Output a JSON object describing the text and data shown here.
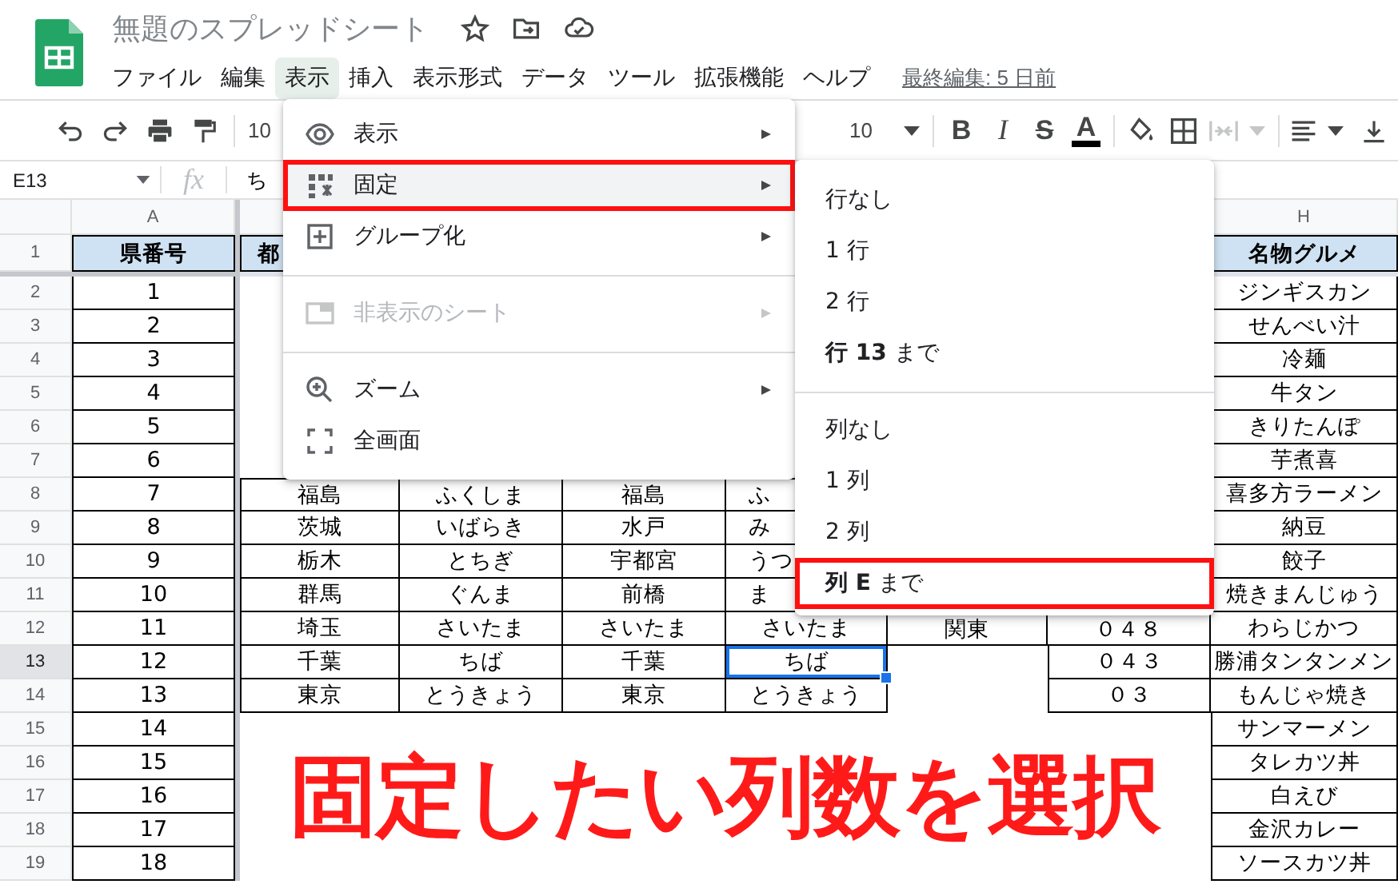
{
  "header": {
    "title": "無題のスプレッドシート",
    "menus": [
      {
        "label": "ファイル",
        "selected": false
      },
      {
        "label": "編集",
        "selected": false
      },
      {
        "label": "表示",
        "selected": true
      },
      {
        "label": "挿入",
        "selected": false
      },
      {
        "label": "表示形式",
        "selected": false
      },
      {
        "label": "データ",
        "selected": false
      },
      {
        "label": "ツール",
        "selected": false
      },
      {
        "label": "拡張機能",
        "selected": false
      },
      {
        "label": "ヘルプ",
        "selected": false
      }
    ],
    "last_edit": "最終編集: 5 日前"
  },
  "toolbar": {
    "zoom": "10",
    "font_size": "10",
    "format_buttons": [
      {
        "label": "B",
        "kind": "bold"
      },
      {
        "label": "I",
        "kind": "italic"
      },
      {
        "label": "S",
        "kind": "strike"
      },
      {
        "label": "A",
        "kind": "color"
      }
    ]
  },
  "formula_bar": {
    "cell": "E13",
    "fx": "fx",
    "value": "ち"
  },
  "sheet": {
    "columns": [
      "A",
      null,
      null,
      null,
      null,
      null,
      null,
      "H"
    ],
    "rows": [
      {
        "number": "1",
        "kind": "header",
        "cells": [
          "県番号",
          "都",
          null,
          null,
          null,
          null,
          null,
          "名物グルメ"
        ]
      },
      {
        "number": "2",
        "kind": "data",
        "cells": [
          "1",
          null,
          null,
          null,
          null,
          null,
          null,
          "ジンギスカン"
        ]
      },
      {
        "number": "3",
        "kind": "data",
        "cells": [
          "2",
          null,
          null,
          null,
          null,
          null,
          null,
          "せんべい汁"
        ]
      },
      {
        "number": "4",
        "kind": "data",
        "cells": [
          "3",
          null,
          null,
          null,
          null,
          null,
          null,
          "冷麺"
        ]
      },
      {
        "number": "5",
        "kind": "data",
        "cells": [
          "4",
          null,
          null,
          null,
          null,
          null,
          null,
          "牛タン"
        ]
      },
      {
        "number": "6",
        "kind": "data",
        "cells": [
          "5",
          null,
          null,
          null,
          null,
          null,
          null,
          "きりたんぽ"
        ]
      },
      {
        "number": "7",
        "kind": "data",
        "cells": [
          "6",
          null,
          null,
          null,
          null,
          null,
          null,
          "芋煮喜"
        ]
      },
      {
        "number": "8",
        "kind": "data",
        "cells": [
          "7",
          "福島",
          "ふくしま",
          "福島",
          "ふ",
          null,
          null,
          "喜多方ラーメン"
        ]
      },
      {
        "number": "9",
        "kind": "data",
        "cells": [
          "8",
          "茨城",
          "いばらき",
          "水戸",
          "み",
          null,
          null,
          "納豆"
        ]
      },
      {
        "number": "10",
        "kind": "data",
        "cells": [
          "9",
          "栃木",
          "とちぎ",
          "宇都宮",
          "うつ",
          null,
          null,
          "餃子"
        ]
      },
      {
        "number": "11",
        "kind": "data",
        "cells": [
          "10",
          "群馬",
          "ぐんま",
          "前橋",
          "ま",
          null,
          null,
          "焼きまんじゅう"
        ]
      },
      {
        "number": "12",
        "kind": "data",
        "cells": [
          "11",
          "埼玉",
          "さいたま",
          "さいたま",
          "さいたま",
          "関東",
          "０４８",
          "わらじかつ"
        ]
      },
      {
        "number": "13",
        "kind": "data",
        "cells": [
          "12",
          "千葉",
          "ちば",
          "千葉",
          {
            "text": "ちば",
            "selected": true
          },
          null,
          "０４３",
          "勝浦タンタンメン"
        ]
      },
      {
        "number": "14",
        "kind": "data",
        "cells": [
          "13",
          "東京",
          "とうきょう",
          "東京",
          "とうきょう",
          null,
          "０３",
          "もんじゃ焼き"
        ]
      },
      {
        "number": "15",
        "kind": "data",
        "cells": [
          "14",
          null,
          null,
          null,
          null,
          null,
          null,
          "サンマーメン"
        ]
      },
      {
        "number": "16",
        "kind": "data",
        "cells": [
          "15",
          null,
          null,
          null,
          null,
          null,
          null,
          "タレカツ丼"
        ]
      },
      {
        "number": "17",
        "kind": "data",
        "cells": [
          "16",
          null,
          null,
          null,
          null,
          null,
          null,
          "白えび"
        ]
      },
      {
        "number": "18",
        "kind": "data",
        "cells": [
          "17",
          null,
          null,
          null,
          null,
          null,
          null,
          "金沢カレー"
        ]
      },
      {
        "number": "19",
        "kind": "data",
        "cells": [
          "18",
          null,
          null,
          null,
          null,
          null,
          null,
          "ソースカツ丼"
        ]
      }
    ]
  },
  "view_menu": {
    "items": [
      {
        "kind": "item",
        "label": "表示",
        "submenu": true,
        "selected": false,
        "highlighted": false,
        "disabled": false
      },
      {
        "kind": "item",
        "label": "固定",
        "submenu": true,
        "selected": true,
        "highlighted": true,
        "disabled": false
      },
      {
        "kind": "item",
        "label": "グループ化",
        "submenu": true,
        "selected": false,
        "highlighted": false,
        "disabled": false
      },
      {
        "kind": "divider"
      },
      {
        "kind": "item",
        "label": "非表示のシート",
        "submenu": true,
        "selected": false,
        "highlighted": false,
        "disabled": true
      },
      {
        "kind": "divider"
      },
      {
        "kind": "item",
        "label": "ズーム",
        "submenu": true,
        "selected": false,
        "highlighted": false,
        "disabled": false
      },
      {
        "kind": "item",
        "label": "全画面",
        "submenu": false,
        "selected": false,
        "highlighted": false,
        "disabled": false
      }
    ]
  },
  "freeze_submenu": {
    "items": [
      {
        "kind": "item",
        "label": "行なし",
        "submenu": false,
        "selected": false,
        "highlighted": false,
        "disabled": false
      },
      {
        "kind": "item",
        "label": "1 行",
        "submenu": false,
        "selected": false,
        "highlighted": false,
        "disabled": false
      },
      {
        "kind": "item",
        "label": "2 行",
        "submenu": false,
        "selected": false,
        "highlighted": false,
        "disabled": false
      },
      {
        "kind": "item",
        "label": "**行 13** まで",
        "submenu": false,
        "selected": false,
        "highlighted": false,
        "disabled": false
      },
      {
        "kind": "divider"
      },
      {
        "kind": "item",
        "label": "列なし",
        "submenu": false,
        "selected": false,
        "highlighted": false,
        "disabled": false
      },
      {
        "kind": "item",
        "label": "1 列",
        "submenu": false,
        "selected": false,
        "highlighted": false,
        "disabled": false
      },
      {
        "kind": "item",
        "label": "2 列",
        "submenu": false,
        "selected": false,
        "highlighted": false,
        "disabled": false
      },
      {
        "kind": "item",
        "label": "**列 E** まで",
        "submenu": false,
        "selected": false,
        "highlighted": true,
        "disabled": false
      }
    ]
  },
  "caption": "固定したい列数を選択"
}
